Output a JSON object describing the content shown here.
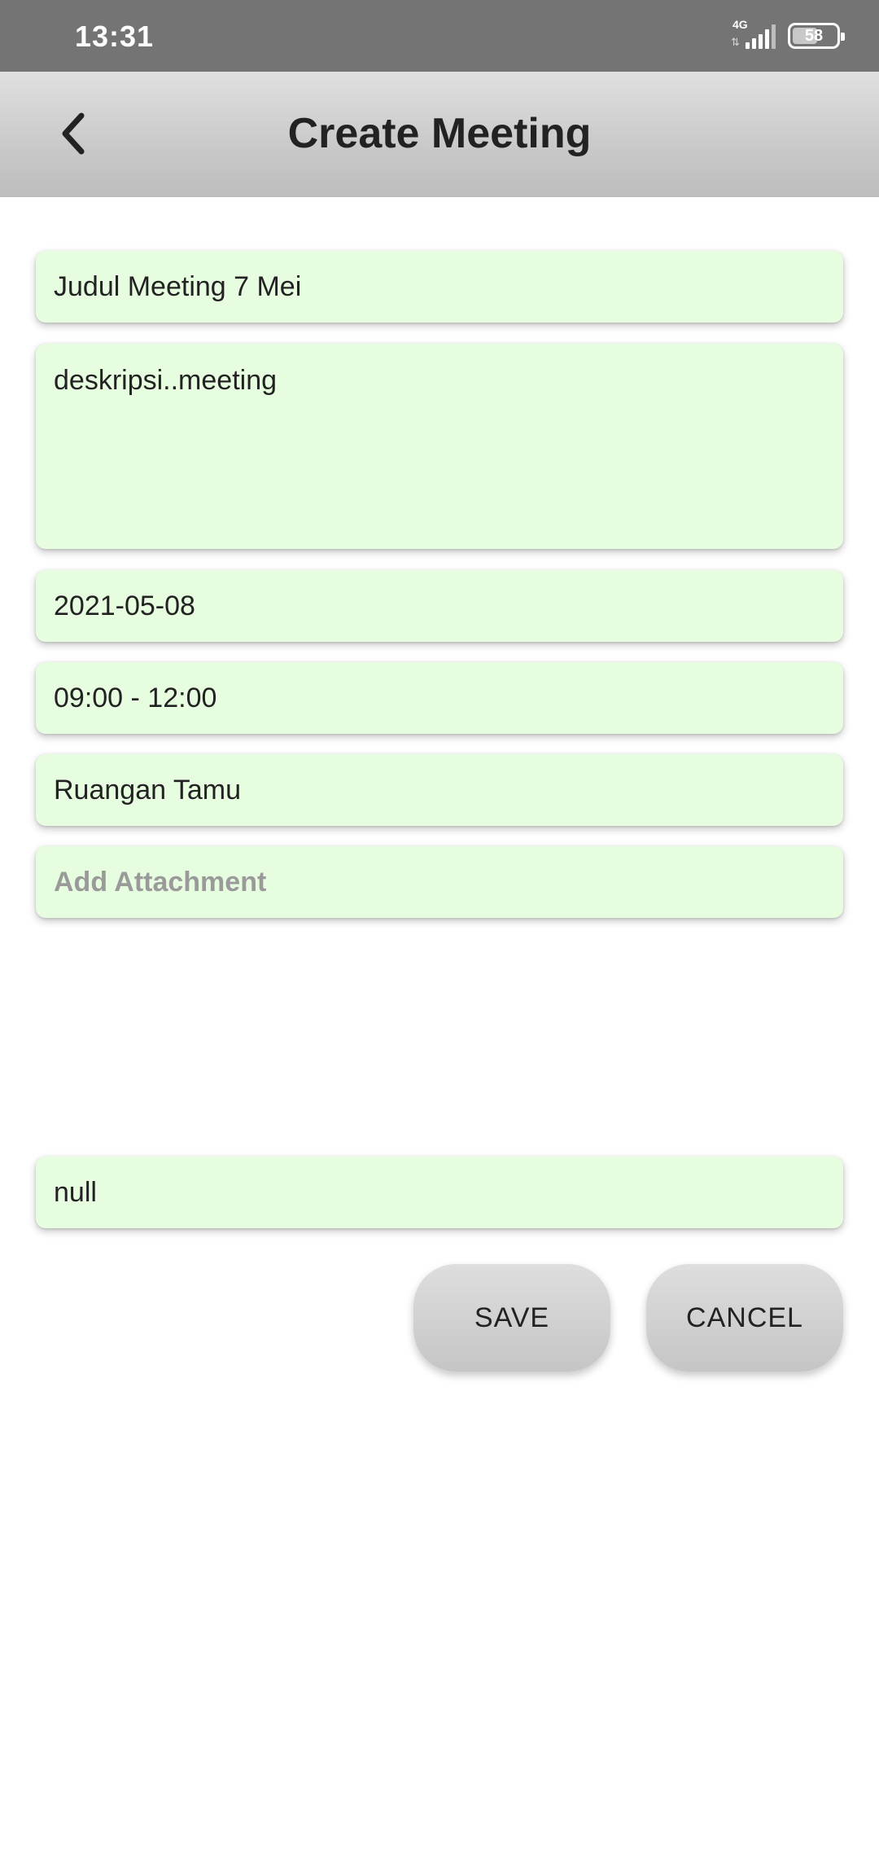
{
  "status_bar": {
    "time": "13:31",
    "network": "4G",
    "battery": "58",
    "battery_level": 0.58
  },
  "app_bar": {
    "title": "Create Meeting",
    "back_icon": "chevron-left-icon"
  },
  "form": {
    "title_value": "Judul Meeting 7 Mei",
    "description_value": "deskripsi..meeting",
    "date_value": "2021-05-08",
    "time_value": "09:00 - 12:00",
    "location_value": "Ruangan Tamu",
    "attachment_placeholder": "Add Attachment",
    "extra_value": "null"
  },
  "actions": {
    "save_label": "SAVE",
    "cancel_label": "CANCEL"
  },
  "colors": {
    "status_bar": "#747474",
    "field_background": "#e7fde0",
    "button_gradient_top": "#dedede",
    "button_gradient_bottom": "#c5c5c5"
  }
}
